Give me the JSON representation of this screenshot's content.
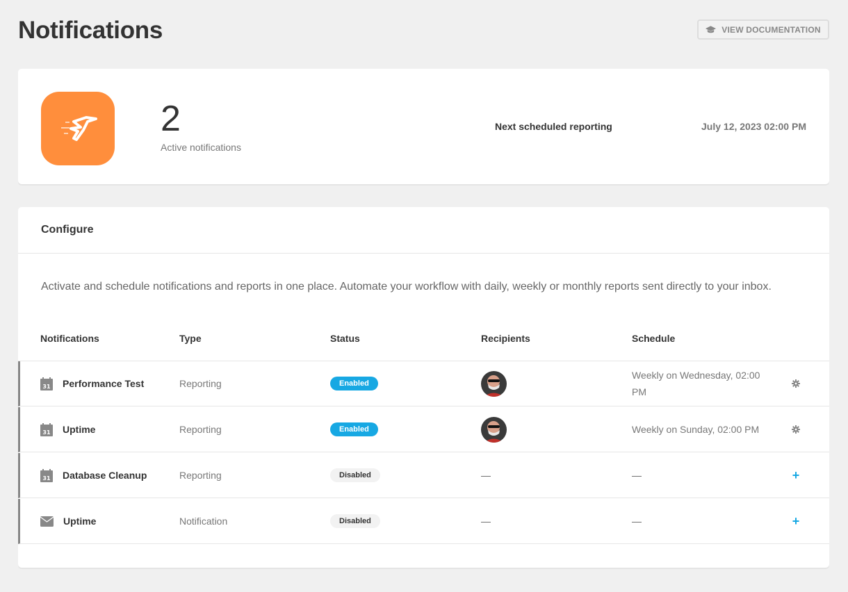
{
  "header": {
    "title": "Notifications",
    "doc_button": "VIEW DOCUMENTATION"
  },
  "summary": {
    "active_count": "2",
    "active_label": "Active notifications",
    "next_label": "Next scheduled reporting",
    "next_date": "July 12, 2023 02:00 PM"
  },
  "configure": {
    "title": "Configure",
    "description": "Activate and schedule notifications and reports in one place. Automate your workflow with daily, weekly or monthly reports sent directly to your inbox.",
    "columns": [
      "Notifications",
      "Type",
      "Status",
      "Recipients",
      "Schedule"
    ],
    "rows": [
      {
        "icon": "calendar-icon",
        "name": "Performance Test",
        "type": "Reporting",
        "status": "Enabled",
        "recipients": "avatar",
        "schedule": "Weekly on Wednesday, 02:00 PM",
        "action": "gear-icon"
      },
      {
        "icon": "calendar-icon",
        "name": "Uptime",
        "type": "Reporting",
        "status": "Enabled",
        "recipients": "avatar",
        "schedule": "Weekly on Sunday, 02:00 PM",
        "action": "gear-icon"
      },
      {
        "icon": "calendar-icon",
        "name": "Database Cleanup",
        "type": "Reporting",
        "status": "Disabled",
        "recipients": "—",
        "schedule": "—",
        "action": "plus-icon"
      },
      {
        "icon": "mail-icon",
        "name": "Uptime",
        "type": "Notification",
        "status": "Disabled",
        "recipients": "—",
        "schedule": "—",
        "action": "plus-icon"
      }
    ]
  },
  "colors": {
    "accent": "#17a8e3",
    "logo_bg": "#ff8e3c",
    "page_bg": "#f0f0f0"
  }
}
